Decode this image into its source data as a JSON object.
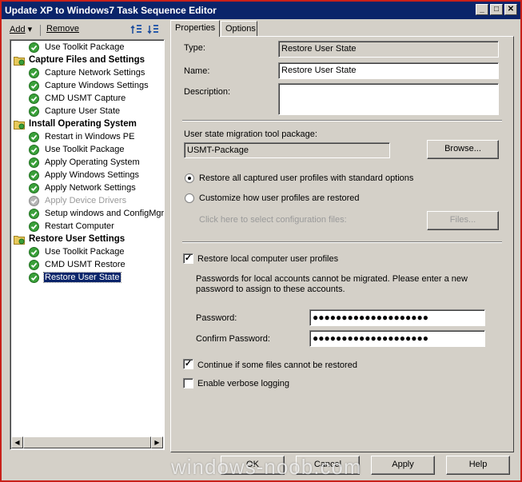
{
  "window": {
    "title": "Update XP to Windows7 Task Sequence Editor",
    "controls": {
      "minimize": "_",
      "maximize": "□",
      "close": "✕"
    }
  },
  "toolbar": {
    "add_label": "Add",
    "add_arrow": "▾",
    "remove_label": "Remove",
    "icons": [
      "move-up-icon",
      "move-down-icon"
    ]
  },
  "tree": {
    "items": [
      {
        "label": "Use Toolkit Package",
        "kind": "step",
        "level": 1
      },
      {
        "label": "Capture Files and Settings",
        "kind": "group",
        "level": 0
      },
      {
        "label": "Capture Network Settings",
        "kind": "step",
        "level": 1
      },
      {
        "label": "Capture Windows Settings",
        "kind": "step",
        "level": 1
      },
      {
        "label": "CMD USMT Capture",
        "kind": "step",
        "level": 1
      },
      {
        "label": "Capture User State",
        "kind": "step",
        "level": 1
      },
      {
        "label": "Install Operating System",
        "kind": "group",
        "level": 0
      },
      {
        "label": "Restart in Windows PE",
        "kind": "step",
        "level": 1
      },
      {
        "label": "Use Toolkit Package",
        "kind": "step",
        "level": 1
      },
      {
        "label": "Apply Operating System",
        "kind": "step",
        "level": 1
      },
      {
        "label": "Apply Windows Settings",
        "kind": "step",
        "level": 1
      },
      {
        "label": "Apply Network Settings",
        "kind": "step",
        "level": 1
      },
      {
        "label": "Apply Device Drivers",
        "kind": "step-disabled",
        "level": 1
      },
      {
        "label": "Setup windows and ConfigMgr",
        "kind": "step",
        "level": 1
      },
      {
        "label": "Restart Computer",
        "kind": "step",
        "level": 1
      },
      {
        "label": "Restore User Settings",
        "kind": "group",
        "level": 0
      },
      {
        "label": "Use Toolkit Package",
        "kind": "step",
        "level": 1
      },
      {
        "label": "CMD USMT Restore",
        "kind": "step",
        "level": 1
      },
      {
        "label": "Restore User State",
        "kind": "step-selected",
        "level": 1
      }
    ],
    "scroll_left": "◀",
    "scroll_right": "▶"
  },
  "tabs": [
    {
      "label": "Properties",
      "active": true
    },
    {
      "label": "Options",
      "active": false
    }
  ],
  "properties": {
    "type_label": "Type:",
    "type_value": "Restore User State",
    "name_label": "Name:",
    "name_value": "Restore User State",
    "description_label": "Description:",
    "description_value": "",
    "package_label": "User state migration tool package:",
    "package_value": "USMT-Package",
    "browse_label": "Browse...",
    "radio_all_label": "Restore all captured user profiles with standard options",
    "radio_custom_label": "Customize how user profiles are restored",
    "config_files_label": "Click here to select configuration files:",
    "files_button_label": "Files...",
    "restore_local_label": "Restore local computer user profiles",
    "restore_local_checked": true,
    "password_note": "Passwords for local accounts cannot be migrated. Please enter a new password to assign to these accounts.",
    "password_label": "Password:",
    "password_value": "●●●●●●●●●●●●●●●●●●●●",
    "confirm_label": "Confirm Password:",
    "confirm_value": "●●●●●●●●●●●●●●●●●●●●",
    "continue_label": "Continue if some files cannot be restored",
    "continue_checked": true,
    "verbose_label": "Enable verbose logging",
    "verbose_checked": false,
    "check_mark": "✓"
  },
  "footer": {
    "ok_label": "OK",
    "cancel_label": "Cancel",
    "apply_label": "Apply",
    "help_label": "Help"
  },
  "watermark": "windows-noob.com"
}
